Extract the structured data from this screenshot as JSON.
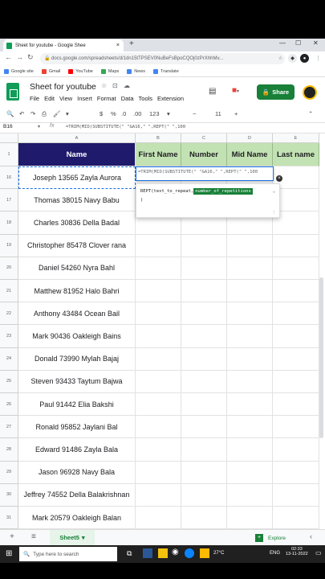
{
  "browser": {
    "tab_title": "Sheet for youtube - Google Shee",
    "tab_close": "×",
    "new_tab": "+",
    "window_minimize": "—",
    "window_maximize": "☐",
    "window_close": "✕",
    "url": "docs.google.com/spreadsheets/d/1dn15tTPSEV0NuBeFsBpoCQOj0zPrXhhMv...",
    "bookmarks": [
      {
        "label": "Google site",
        "color": "#4285f4"
      },
      {
        "label": "Gmail",
        "color": "#ea4335"
      },
      {
        "label": "YouTube",
        "color": "#ff0000"
      },
      {
        "label": "Maps",
        "color": "#34a853"
      },
      {
        "label": "News",
        "color": "#4285f4"
      },
      {
        "label": "Translate",
        "color": "#4285f4"
      }
    ]
  },
  "doc": {
    "title": "Sheet for youtube",
    "menu": [
      "File",
      "Edit",
      "View",
      "Insert",
      "Format",
      "Data",
      "Tools",
      "Extension"
    ],
    "share_label": "Share",
    "toolbar": {
      "currency": "$",
      "percent": "%",
      "dec_less": ".0",
      "dec_more": ".00",
      "format": "123",
      "font_size": "11"
    }
  },
  "formula_bar": {
    "name_box": "B16",
    "fx": "fx",
    "formula": "=TRIM(MID(SUBSTITUTE(\" \"&A16,\" \",REPT(\" \",100"
  },
  "columns": [
    "A",
    "B",
    "C",
    "D",
    "E"
  ],
  "header_row": {
    "row_num": "1",
    "cells": [
      "Name",
      "First Name",
      "Number",
      "Mid Name",
      "Last name"
    ]
  },
  "rows": [
    {
      "num": "16",
      "name": "Joseph 13565 Zayla Aurora"
    },
    {
      "num": "17",
      "name": "Thomas 38015 Navy Babu"
    },
    {
      "num": "18",
      "name": "Charles 30836 Della Badal"
    },
    {
      "num": "19",
      "name": "Christopher 85478 Clover rana"
    },
    {
      "num": "20",
      "name": "Daniel 54260 Nyra Bahl"
    },
    {
      "num": "21",
      "name": "Matthew 81952 Halo Bahri"
    },
    {
      "num": "22",
      "name": "Anthony 43484 Ocean Bail"
    },
    {
      "num": "23",
      "name": "Mark 90436 Oakleigh Bains"
    },
    {
      "num": "24",
      "name": "Donald 73990 Mylah Bajaj"
    },
    {
      "num": "25",
      "name": "Steven 93433 Taytum Bajwa"
    },
    {
      "num": "26",
      "name": "Paul 91442 Elia Bakshi"
    },
    {
      "num": "27",
      "name": "Ronald 95852 Jaylani Bal"
    },
    {
      "num": "28",
      "name": "Edward 91486 Zayla Bala"
    },
    {
      "num": "29",
      "name": "Jason 96928 Navy Bala"
    },
    {
      "num": "30",
      "name": "Jeffrey 74552 Della Balakrishnan"
    },
    {
      "num": "31",
      "name": "Mark 20579 Oakleigh Balan"
    }
  ],
  "editor": {
    "text": "=TRIM(MID(SUBSTITUTE(\" \"&A16,\" \",REPT(\" \",100",
    "close": "×"
  },
  "tooltip": {
    "func": "REPT(text_to_repeat, ",
    "highlight": "number_of_repetitions",
    "close": ")"
  },
  "sheets": {
    "add": "+",
    "list_icon": "≡",
    "active": "Sheet5",
    "explore": "Explore"
  },
  "taskbar": {
    "search_placeholder": "Type here to search",
    "weather": "27°C",
    "lang": "ENG",
    "time": "02:33",
    "date": "13-11-2022"
  },
  "colors": {
    "header_dark": "#1f1a6b",
    "header_green": "#c3e2b3",
    "share_green": "#188038"
  }
}
